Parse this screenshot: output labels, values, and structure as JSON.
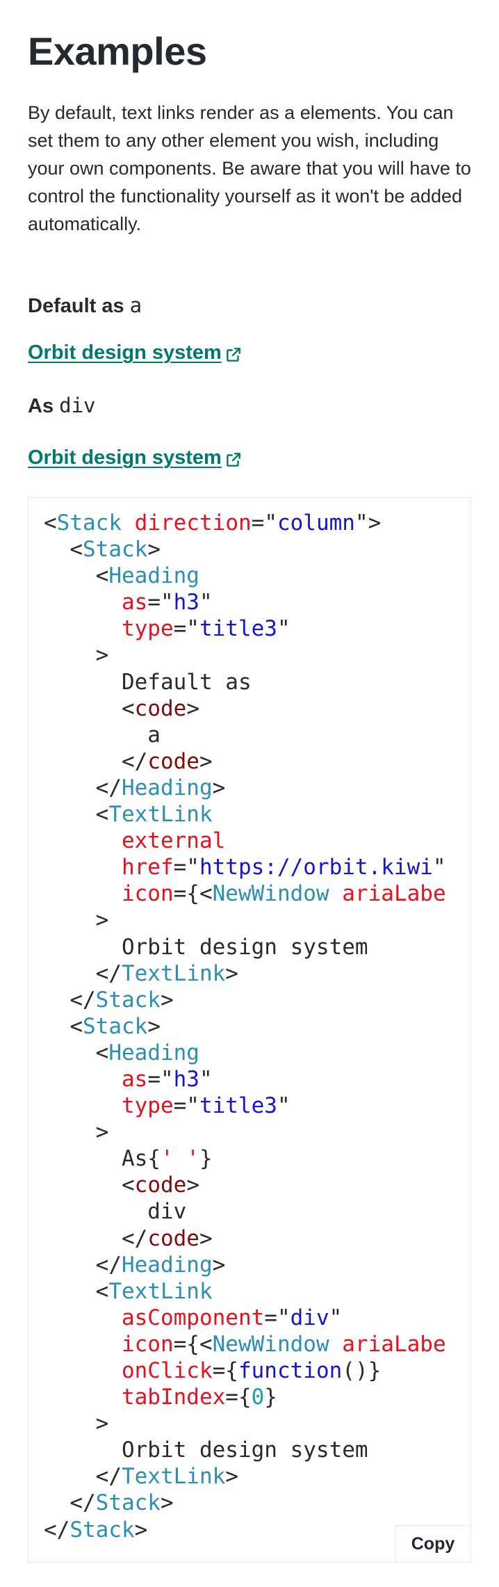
{
  "page": {
    "title": "Examples",
    "intro": "By default, text links render as a elements. You can set them to any other element you wish, including your own components. Be aware that you will have to control the functionality yourself as it won't be added automatically."
  },
  "examples": [
    {
      "heading_prefix": "Default as",
      "heading_code": "a",
      "link_text": "Orbit design system",
      "link_icon": "new-window-icon"
    },
    {
      "heading_prefix": "As",
      "heading_code": "div",
      "link_text": "Orbit design system",
      "link_icon": "new-window-icon"
    }
  ],
  "code_block": {
    "language": "jsx",
    "copy_label": "Copy",
    "lines": [
      "<Stack direction=\"column\">",
      "  <Stack>",
      "    <Heading",
      "      as=\"h3\"",
      "      type=\"title3\"",
      "    >",
      "      Default as",
      "      <code>",
      "        a",
      "      </code>",
      "    </Heading>",
      "    <TextLink",
      "      external",
      "      href=\"https://orbit.kiwi\"",
      "      icon={<NewWindow ariaLabe",
      "    >",
      "      Orbit design system",
      "    </TextLink>",
      "  </Stack>",
      "  <Stack>",
      "    <Heading",
      "      as=\"h3\"",
      "      type=\"title3\"",
      "    >",
      "      As{' '}",
      "      <code>",
      "        div",
      "      </code>",
      "    </Heading>",
      "    <TextLink",
      "      asComponent=\"div\"",
      "      icon={<NewWindow ariaLabe",
      "      onClick={function()}",
      "      tabIndex={0}",
      "    >",
      "      Orbit design system",
      "    </TextLink>",
      "  </Stack>",
      "</Stack>"
    ]
  },
  "colors": {
    "text": "#252a31",
    "link": "#007a6c",
    "tag": "#2a8fb2",
    "attribute": "#e8101e",
    "string": "#1414d2",
    "code_tag": "#7d0b0b",
    "number": "#17a2a0",
    "border": "#e5e8ec"
  }
}
